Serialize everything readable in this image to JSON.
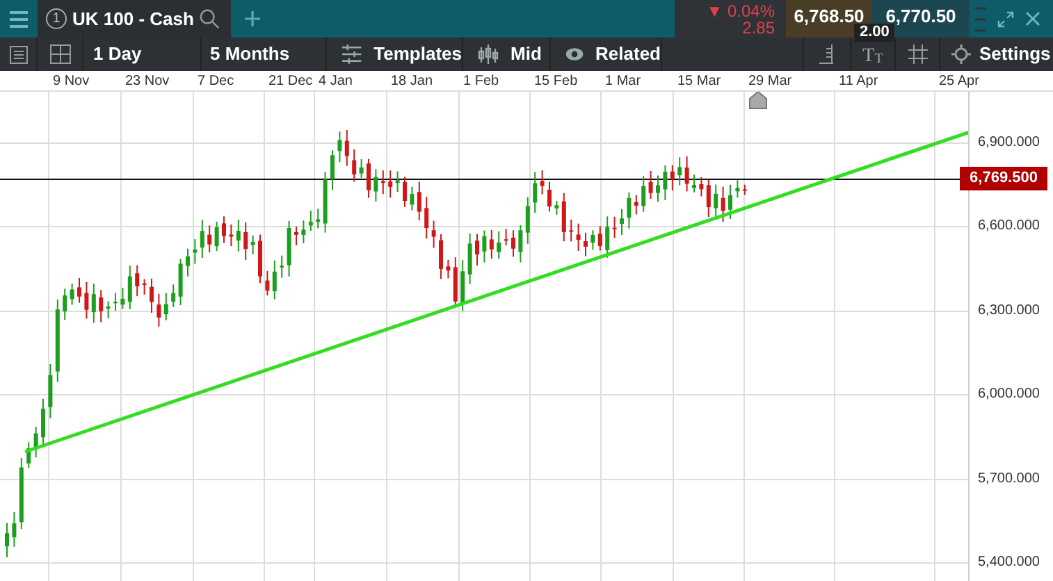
{
  "header": {
    "tab": {
      "number": "1",
      "label": "UK 100 - Cash",
      "selected": true
    },
    "change": {
      "arrow": "▼",
      "percent": "0.04%",
      "points": "2.85"
    },
    "sell_price": "6,768.50",
    "buy_price": "6,770.50",
    "spread": "2.00"
  },
  "toolbar": {
    "interval": "1 Day",
    "range": "5 Months",
    "buttons": [
      {
        "label": "Templates",
        "kind": "templates"
      },
      {
        "label": "Mid",
        "kind": "mid"
      },
      {
        "label": "Related",
        "kind": "related"
      }
    ],
    "text_tool": "TT",
    "settings": "Settings"
  },
  "chart": {
    "dates": [
      "9 Nov",
      "23 Nov",
      "7 Dec",
      "21 Dec",
      "4 Jan",
      "18 Jan",
      "1 Feb",
      "15 Feb",
      "1 Mar",
      "15 Mar",
      "29 Mar",
      "11 Apr",
      "25 Apr"
    ],
    "price_axis": [
      "6,900.000",
      "6,600.000",
      "6,300.000",
      "6,000.000",
      "5,700.000",
      "5,400.000"
    ],
    "current_price": "6,769.500"
  }
}
